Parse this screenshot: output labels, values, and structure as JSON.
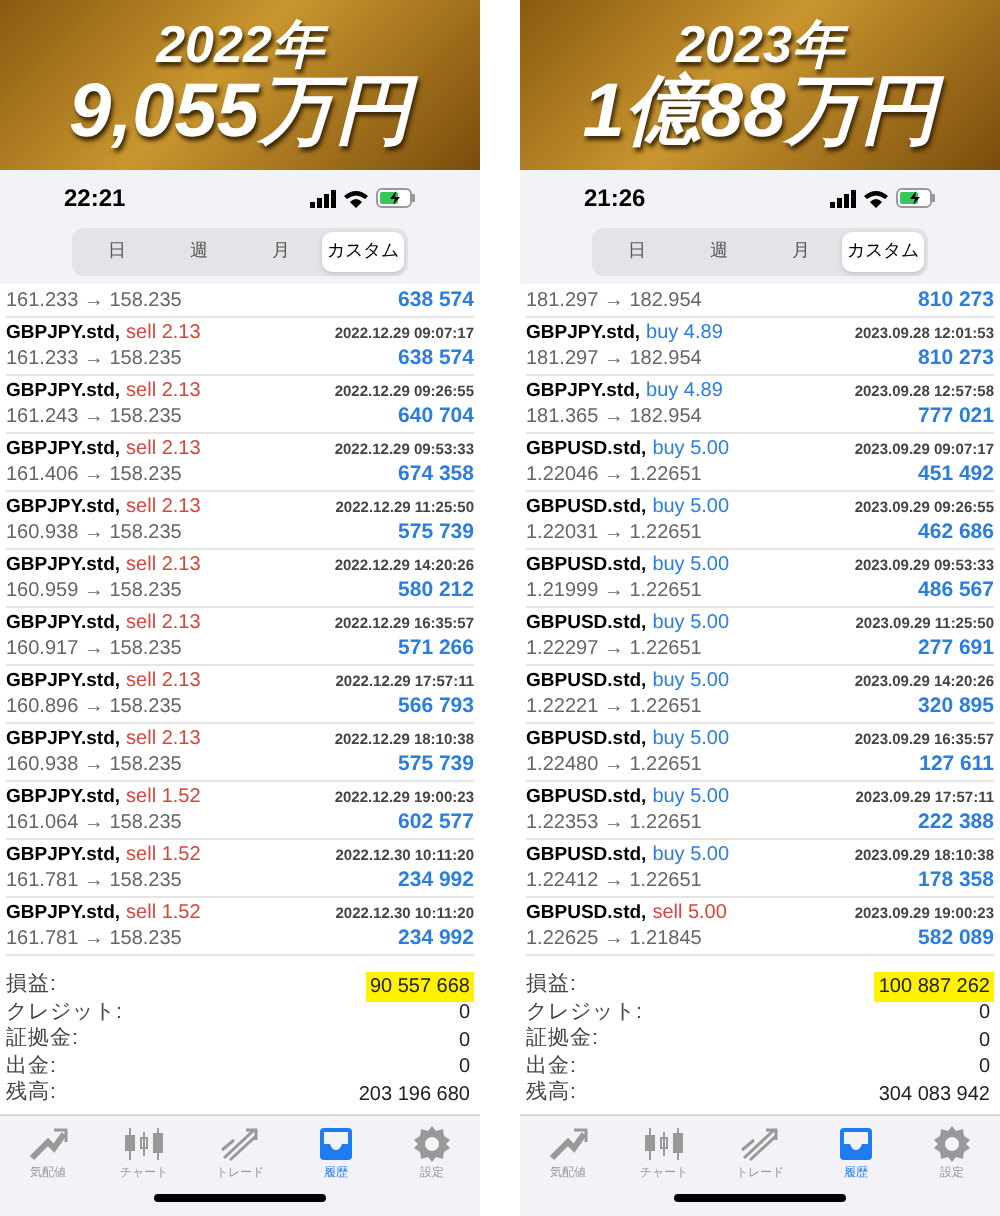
{
  "panels": [
    {
      "banner": {
        "year": "2022年",
        "amount": "9,055万円"
      },
      "status_bar": {
        "time": "22:21"
      },
      "tabs": [
        {
          "label": "日",
          "selected": false
        },
        {
          "label": "週",
          "selected": false
        },
        {
          "label": "月",
          "selected": false
        },
        {
          "label": "カスタム",
          "selected": true
        }
      ],
      "first_row": {
        "prices": "161.233 → 158.235",
        "profit": "638 574"
      },
      "trades": [
        {
          "symbol": "GBPJPY.std,",
          "kind": "sell",
          "order": "sell 2.13",
          "time": "2022.12.29 09:07:17",
          "prices": "161.233 → 158.235",
          "profit": "638 574"
        },
        {
          "symbol": "GBPJPY.std,",
          "kind": "sell",
          "order": "sell 2.13",
          "time": "2022.12.29 09:26:55",
          "prices": "161.243 → 158.235",
          "profit": "640 704"
        },
        {
          "symbol": "GBPJPY.std,",
          "kind": "sell",
          "order": "sell 2.13",
          "time": "2022.12.29 09:53:33",
          "prices": "161.406 → 158.235",
          "profit": "674 358"
        },
        {
          "symbol": "GBPJPY.std,",
          "kind": "sell",
          "order": "sell 2.13",
          "time": "2022.12.29 11:25:50",
          "prices": "160.938 → 158.235",
          "profit": "575 739"
        },
        {
          "symbol": "GBPJPY.std,",
          "kind": "sell",
          "order": "sell 2.13",
          "time": "2022.12.29 14:20:26",
          "prices": "160.959 → 158.235",
          "profit": "580 212"
        },
        {
          "symbol": "GBPJPY.std,",
          "kind": "sell",
          "order": "sell 2.13",
          "time": "2022.12.29 16:35:57",
          "prices": "160.917 → 158.235",
          "profit": "571 266"
        },
        {
          "symbol": "GBPJPY.std,",
          "kind": "sell",
          "order": "sell 2.13",
          "time": "2022.12.29 17:57:11",
          "prices": "160.896 → 158.235",
          "profit": "566 793"
        },
        {
          "symbol": "GBPJPY.std,",
          "kind": "sell",
          "order": "sell 2.13",
          "time": "2022.12.29 18:10:38",
          "prices": "160.938 → 158.235",
          "profit": "575 739"
        },
        {
          "symbol": "GBPJPY.std,",
          "kind": "sell",
          "order": "sell 1.52",
          "time": "2022.12.29 19:00:23",
          "prices": "161.064 → 158.235",
          "profit": "602 577"
        },
        {
          "symbol": "GBPJPY.std,",
          "kind": "sell",
          "order": "sell 1.52",
          "time": "2022.12.30 10:11:20",
          "prices": "161.781 → 158.235",
          "profit": "234 992"
        },
        {
          "symbol": "GBPJPY.std,",
          "kind": "sell",
          "order": "sell 1.52",
          "time": "2022.12.30 10:11:20",
          "prices": "161.781 → 158.235",
          "profit": "234 992"
        }
      ],
      "summary": [
        {
          "label": "損益:",
          "value": "90 557 668",
          "highlighted": true
        },
        {
          "label": "クレジット:",
          "value": "0",
          "highlighted": false
        },
        {
          "label": "証拠金:",
          "value": "0",
          "highlighted": false
        },
        {
          "label": "出金:",
          "value": "0",
          "highlighted": false
        },
        {
          "label": "残高:",
          "value": "203 196 680",
          "highlighted": false
        }
      ],
      "tab_bar": [
        {
          "label": "気配値",
          "selected": false
        },
        {
          "label": "チャート",
          "selected": false
        },
        {
          "label": "トレード",
          "selected": false
        },
        {
          "label": "履歴",
          "selected": true
        },
        {
          "label": "設定",
          "selected": false
        }
      ]
    },
    {
      "banner": {
        "year": "2023年",
        "amount": "1億88万円"
      },
      "status_bar": {
        "time": "21:26"
      },
      "tabs": [
        {
          "label": "日",
          "selected": false
        },
        {
          "label": "週",
          "selected": false
        },
        {
          "label": "月",
          "selected": false
        },
        {
          "label": "カスタム",
          "selected": true
        }
      ],
      "first_row": {
        "prices": "181.297 → 182.954",
        "profit": "810 273"
      },
      "trades": [
        {
          "symbol": "GBPJPY.std,",
          "kind": "buy",
          "order": "buy 4.89",
          "time": "2023.09.28 12:01:53",
          "prices": "181.297 → 182.954",
          "profit": "810 273"
        },
        {
          "symbol": "GBPJPY.std,",
          "kind": "buy",
          "order": "buy 4.89",
          "time": "2023.09.28 12:57:58",
          "prices": "181.365 → 182.954",
          "profit": "777 021"
        },
        {
          "symbol": "GBPUSD.std,",
          "kind": "buy",
          "order": "buy 5.00",
          "time": "2023.09.29 09:07:17",
          "prices": "1.22046 → 1.22651",
          "profit": "451 492"
        },
        {
          "symbol": "GBPUSD.std,",
          "kind": "buy",
          "order": "buy 5.00",
          "time": "2023.09.29 09:26:55",
          "prices": "1.22031 → 1.22651",
          "profit": "462 686"
        },
        {
          "symbol": "GBPUSD.std,",
          "kind": "buy",
          "order": "buy 5.00",
          "time": "2023.09.29 09:53:33",
          "prices": "1.21999 → 1.22651",
          "profit": "486 567"
        },
        {
          "symbol": "GBPUSD.std,",
          "kind": "buy",
          "order": "buy 5.00",
          "time": "2023.09.29 11:25:50",
          "prices": "1.22297 → 1.22651",
          "profit": "277 691"
        },
        {
          "symbol": "GBPUSD.std,",
          "kind": "buy",
          "order": "buy 5.00",
          "time": "2023.09.29 14:20:26",
          "prices": "1.22221 → 1.22651",
          "profit": "320 895"
        },
        {
          "symbol": "GBPUSD.std,",
          "kind": "buy",
          "order": "buy 5.00",
          "time": "2023.09.29 16:35:57",
          "prices": "1.22480 → 1.22651",
          "profit": "127 611"
        },
        {
          "symbol": "GBPUSD.std,",
          "kind": "buy",
          "order": "buy 5.00",
          "time": "2023.09.29 17:57:11",
          "prices": "1.22353 → 1.22651",
          "profit": "222 388"
        },
        {
          "symbol": "GBPUSD.std,",
          "kind": "buy",
          "order": "buy 5.00",
          "time": "2023.09.29 18:10:38",
          "prices": "1.22412 → 1.22651",
          "profit": "178 358"
        },
        {
          "symbol": "GBPUSD.std,",
          "kind": "sell",
          "order": "sell 5.00",
          "time": "2023.09.29 19:00:23",
          "prices": "1.22625 → 1.21845",
          "profit": "582 089"
        }
      ],
      "summary": [
        {
          "label": "損益:",
          "value": "100 887 262",
          "highlighted": true
        },
        {
          "label": "クレジット:",
          "value": "0",
          "highlighted": false
        },
        {
          "label": "証拠金:",
          "value": "0",
          "highlighted": false
        },
        {
          "label": "出金:",
          "value": "0",
          "highlighted": false
        },
        {
          "label": "残高:",
          "value": "304 083 942",
          "highlighted": false
        }
      ],
      "tab_bar": [
        {
          "label": "気配値",
          "selected": false
        },
        {
          "label": "チャート",
          "selected": false
        },
        {
          "label": "トレード",
          "selected": false
        },
        {
          "label": "履歴",
          "selected": true
        },
        {
          "label": "設定",
          "selected": false
        }
      ]
    }
  ]
}
